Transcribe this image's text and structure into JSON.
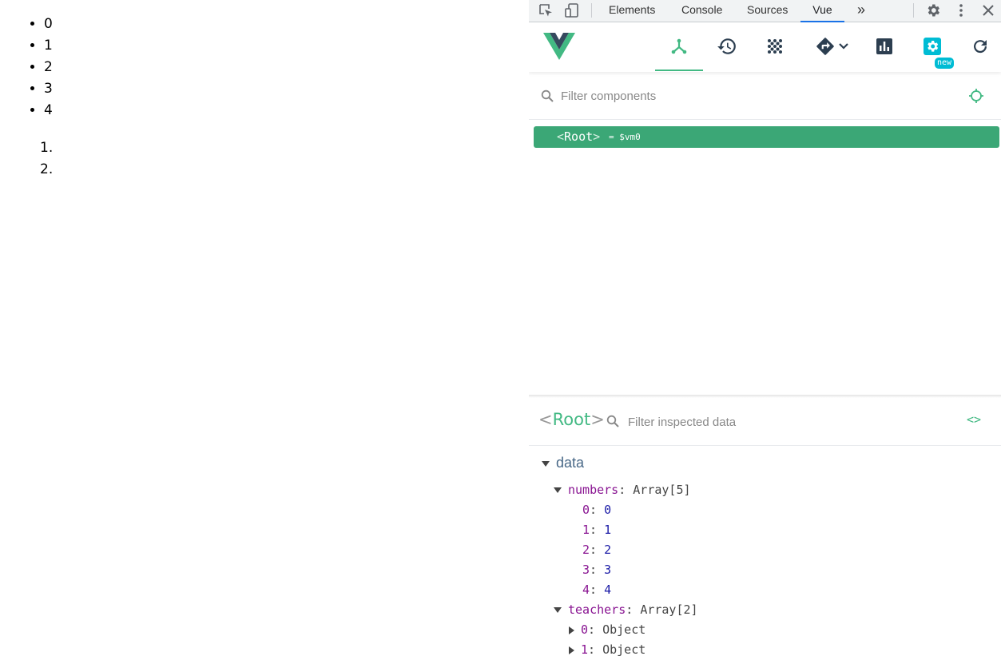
{
  "page": {
    "unordered_list": [
      "0",
      "1",
      "2",
      "3",
      "4"
    ],
    "ordered_list_markers": [
      "1.",
      "2."
    ]
  },
  "devtools": {
    "tabs": [
      "Elements",
      "Console",
      "Sources",
      "Vue"
    ],
    "active_tab": "Vue",
    "overflow_label": "»",
    "toolbar_icons": [
      "inspect-element-icon",
      "device-toolbar-icon",
      "settings-gear-icon",
      "more-vertical-icon",
      "close-icon"
    ]
  },
  "vue": {
    "accent": "#42b983",
    "toolbar_buttons": [
      "components",
      "timeline",
      "vuex",
      "routing",
      "performance",
      "settings",
      "refresh"
    ],
    "settings_badge": "new",
    "component_filter_placeholder": "Filter components",
    "selected_component": {
      "name": "Root",
      "vm": "= $vm0"
    },
    "inspector": {
      "component_name": "Root",
      "filter_placeholder": "Filter inspected data",
      "code_toggle": "<>",
      "section": "data",
      "numbers": {
        "key": "numbers",
        "type": "Array[5]",
        "items": [
          {
            "index": "0",
            "value": "0"
          },
          {
            "index": "1",
            "value": "1"
          },
          {
            "index": "2",
            "value": "2"
          },
          {
            "index": "3",
            "value": "3"
          },
          {
            "index": "4",
            "value": "4"
          }
        ]
      },
      "teachers": {
        "key": "teachers",
        "type": "Array[2]",
        "items": [
          {
            "index": "0",
            "value": "Object"
          },
          {
            "index": "1",
            "value": "Object"
          }
        ]
      }
    }
  }
}
